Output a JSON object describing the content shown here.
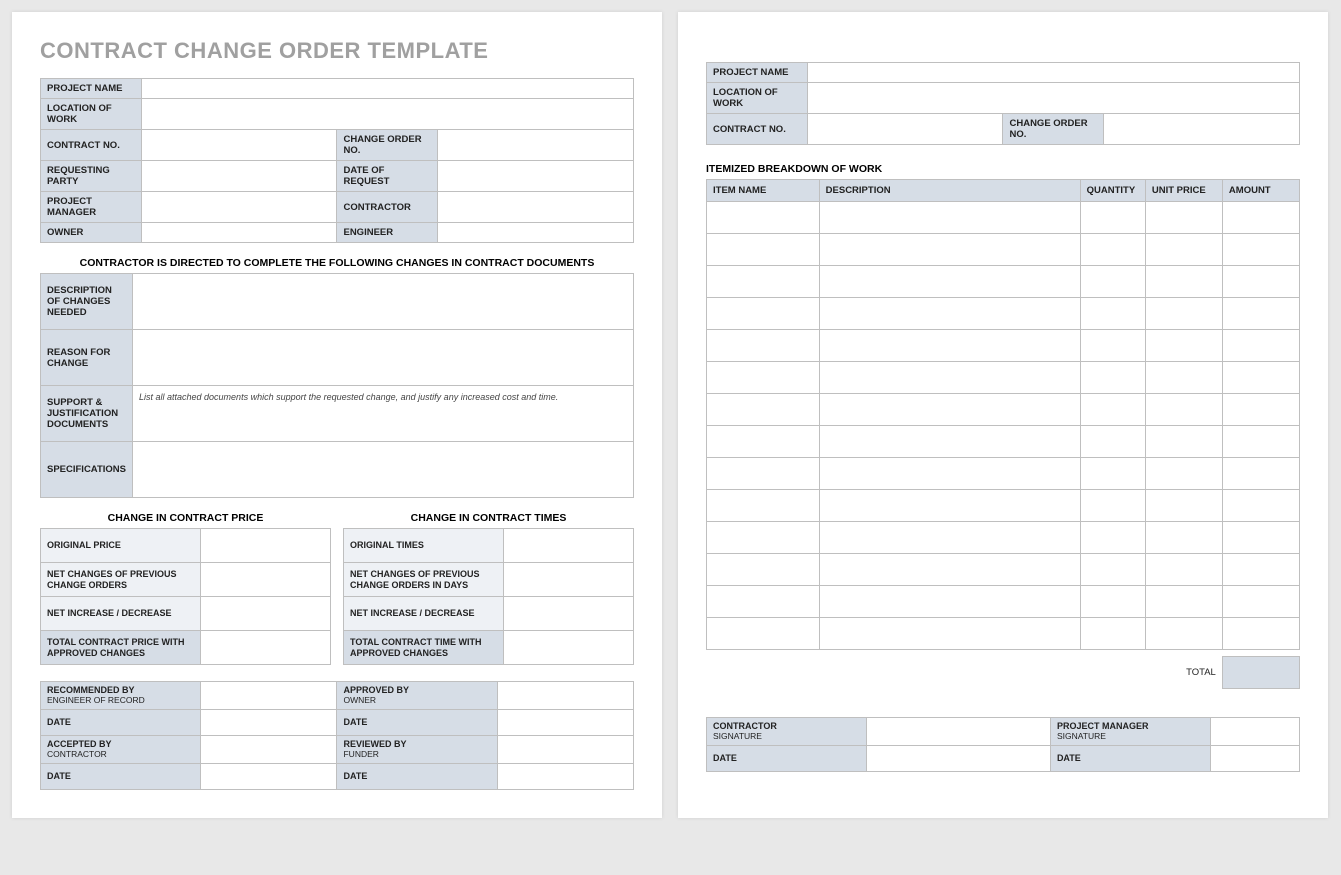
{
  "title": "CONTRACT CHANGE ORDER TEMPLATE",
  "info": {
    "project_name_label": "PROJECT NAME",
    "location_label": "LOCATION OF WORK",
    "contract_no_label": "CONTRACT NO.",
    "change_order_no_label": "CHANGE ORDER NO.",
    "requesting_party_label": "REQUESTING PARTY",
    "date_of_request_label": "DATE OF REQUEST",
    "project_manager_label": "PROJECT MANAGER",
    "contractor_label": "CONTRACTOR",
    "owner_label": "OWNER",
    "engineer_label": "ENGINEER"
  },
  "changes_heading": "CONTRACTOR IS DIRECTED TO COMPLETE THE FOLLOWING CHANGES IN CONTRACT DOCUMENTS",
  "changes": {
    "description_label": "DESCRIPTION OF CHANGES NEEDED",
    "reason_label": "REASON FOR CHANGE",
    "support_label": "SUPPORT & JUSTIFICATION DOCUMENTS",
    "support_hint": "List all attached documents which support the requested change, and justify any increased cost and time.",
    "specifications_label": "SPECIFICATIONS"
  },
  "price_heading": "CHANGE IN CONTRACT PRICE",
  "times_heading": "CHANGE IN CONTRACT TIMES",
  "price": {
    "original": "ORIGINAL PRICE",
    "net_prev": "NET CHANGES OF PREVIOUS CHANGE ORDERS",
    "net_inc": "NET INCREASE / DECREASE",
    "total": "TOTAL CONTRACT PRICE WITH APPROVED CHANGES"
  },
  "times": {
    "original": "ORIGINAL TIMES",
    "net_prev": "NET CHANGES OF PREVIOUS CHANGE ORDERS IN DAYS",
    "net_inc": "NET INCREASE / DECREASE",
    "total": "TOTAL CONTRACT TIME WITH APPROVED CHANGES"
  },
  "sig1": {
    "recommended": "RECOMMENDED BY",
    "recommended_sub": "ENGINEER OF RECORD",
    "approved": "APPROVED BY",
    "approved_sub": "OWNER",
    "accepted": "ACCEPTED BY",
    "accepted_sub": "CONTRACTOR",
    "reviewed": "REVIEWED BY",
    "reviewed_sub": "FUNDER",
    "date": "DATE"
  },
  "itemized_heading": "ITEMIZED BREAKDOWN OF WORK",
  "item_headers": {
    "name": "ITEM NAME",
    "desc": "DESCRIPTION",
    "qty": "QUANTITY",
    "price": "UNIT PRICE",
    "amount": "AMOUNT"
  },
  "total_label": "TOTAL",
  "sig2": {
    "contractor": "CONTRACTOR",
    "pm": "PROJECT MANAGER",
    "signature": "SIGNATURE",
    "date": "DATE"
  }
}
